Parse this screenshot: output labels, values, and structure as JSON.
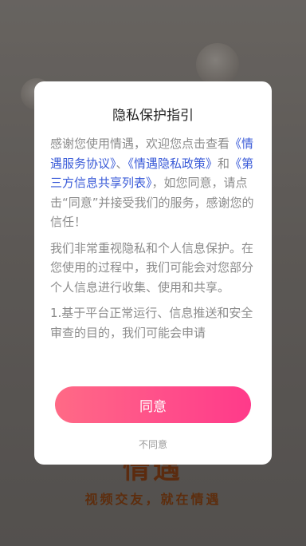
{
  "background": {
    "logo_text": "情遇",
    "slogan": "视频交友，就在情遇"
  },
  "dialog": {
    "title": "隐私保护指引",
    "para1": {
      "text1": "感谢您使用情遇，欢迎您点击查看",
      "link1": "《情遇服务协议》",
      "sep1": "、",
      "link2": "《情遇隐私政策》",
      "sep2": "和",
      "link3": "《第三方信息共享列表》",
      "text2": "，如您同意，请点击“同意”并接受我们的服务，感谢您的信任！"
    },
    "para2": "我们非常重视隐私和个人信息保护。在您使用的过程中，我们可能会对您部分个人信息进行收集、使用和共享。",
    "para3": "1.基于平台正常运行、信息推送和安全审查的目的，我们可能会申请",
    "agree_label": "同意",
    "disagree_label": "不同意"
  }
}
